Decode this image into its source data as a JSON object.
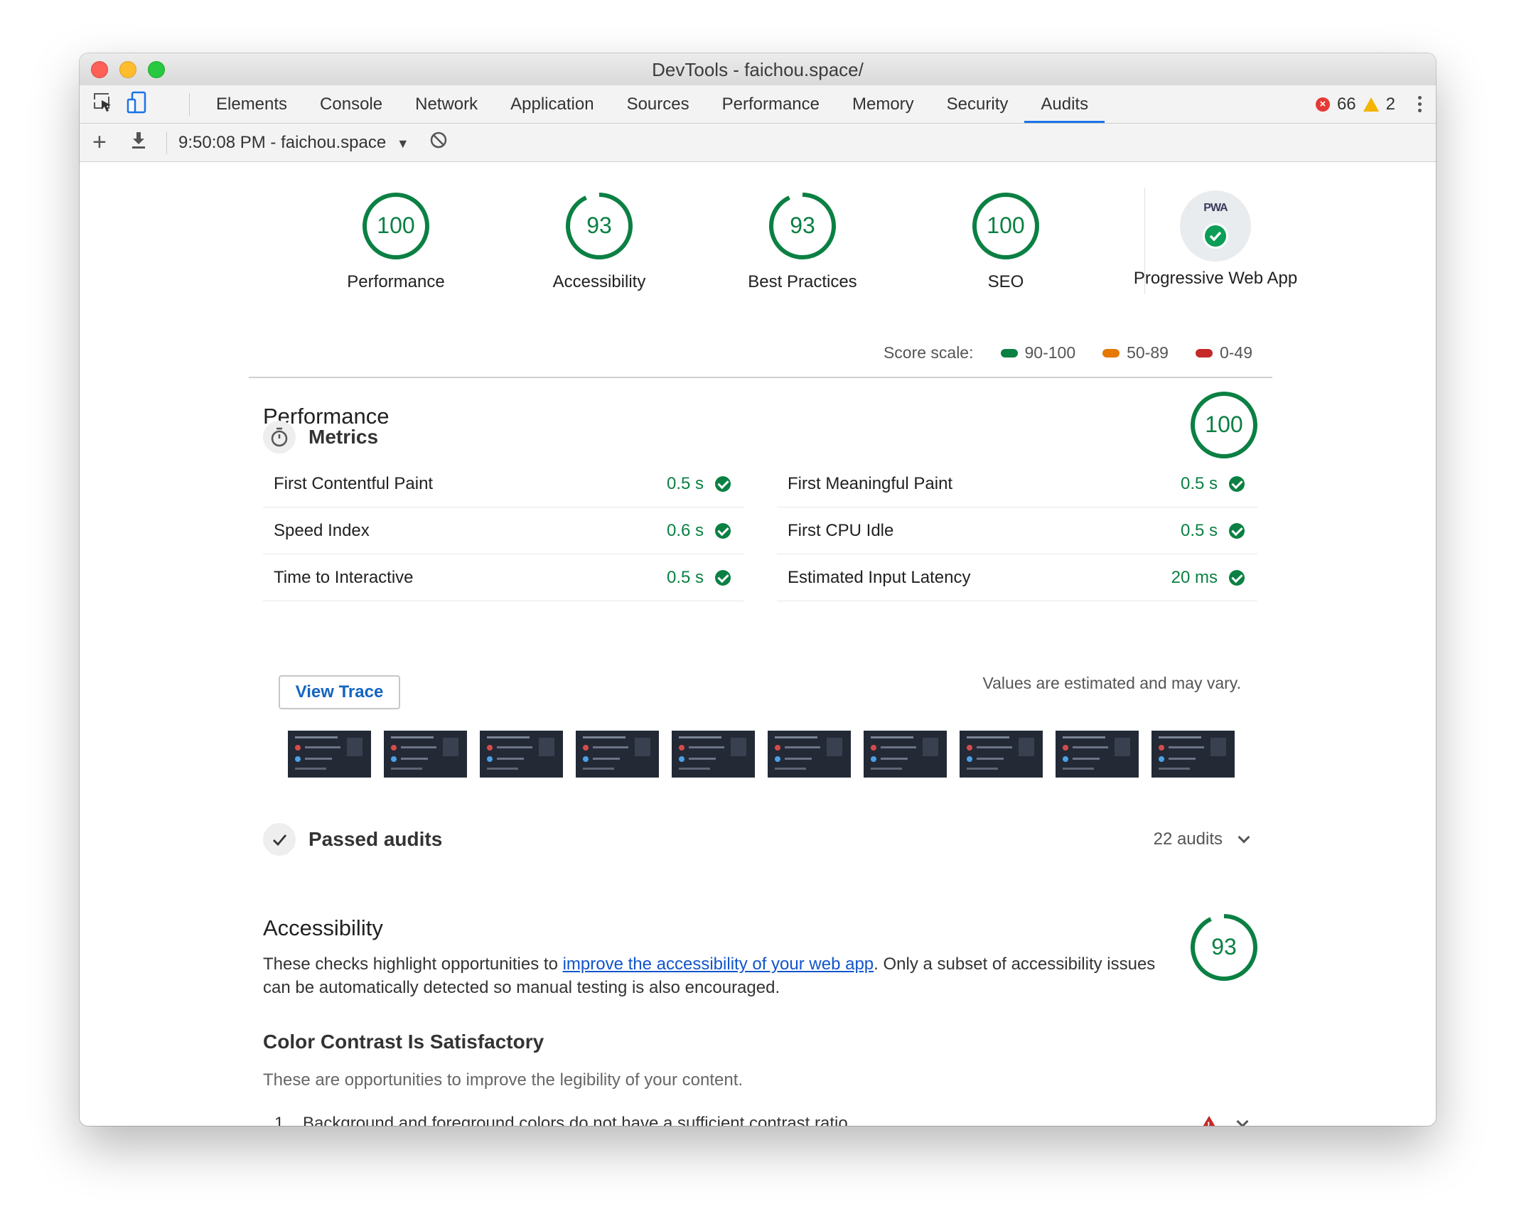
{
  "window": {
    "title": "DevTools - faichou.space/"
  },
  "tabs": [
    {
      "label": "Elements"
    },
    {
      "label": "Console"
    },
    {
      "label": "Network"
    },
    {
      "label": "Application"
    },
    {
      "label": "Sources"
    },
    {
      "label": "Performance"
    },
    {
      "label": "Memory"
    },
    {
      "label": "Security"
    },
    {
      "label": "Audits",
      "active": true
    }
  ],
  "status": {
    "errors": "66",
    "warnings": "2"
  },
  "toolbar": {
    "report_label": "9:50:08 PM - faichou.space"
  },
  "summary": {
    "gauges": [
      {
        "label": "Performance",
        "score": 100
      },
      {
        "label": "Accessibility",
        "score": 93
      },
      {
        "label": "Best Practices",
        "score": 93
      },
      {
        "label": "SEO",
        "score": 100
      }
    ],
    "pwa": {
      "label": "Progressive Web App",
      "badge": "PWA"
    },
    "scale": {
      "label": "Score scale:",
      "ranges": [
        {
          "label": "90-100",
          "color": "#0b8043"
        },
        {
          "label": "50-89",
          "color": "#e67700"
        },
        {
          "label": "0-49",
          "color": "#c62828"
        }
      ]
    }
  },
  "performance": {
    "title": "Performance",
    "score": 100,
    "metrics_title": "Metrics",
    "metrics_left": [
      {
        "name": "First Contentful Paint",
        "value": "0.5 s"
      },
      {
        "name": "Speed Index",
        "value": "0.6 s"
      },
      {
        "name": "Time to Interactive",
        "value": "0.5 s"
      }
    ],
    "metrics_right": [
      {
        "name": "First Meaningful Paint",
        "value": "0.5 s"
      },
      {
        "name": "First CPU Idle",
        "value": "0.5 s"
      },
      {
        "name": "Estimated Input Latency",
        "value": "20 ms"
      }
    ],
    "view_trace": "View Trace",
    "note": "Values are estimated and may vary.",
    "filmstrip_frames": 10,
    "passed_title": "Passed audits",
    "passed_count": "22 audits"
  },
  "accessibility": {
    "title": "Accessibility",
    "score": 93,
    "desc_before": "These checks highlight opportunities to ",
    "desc_link": "improve the accessibility of your web app",
    "desc_after": ". Only a subset of accessibility issues can be automatically detected so manual testing is also encouraged.",
    "group_title": "Color Contrast Is Satisfactory",
    "group_desc": "These are opportunities to improve the legibility of your content.",
    "audits": [
      {
        "num": "1",
        "text": "Background and foreground colors do not have a sufficient contrast ratio."
      }
    ]
  },
  "colors": {
    "pass": "#0b8043",
    "accent": "#1a73e8"
  }
}
